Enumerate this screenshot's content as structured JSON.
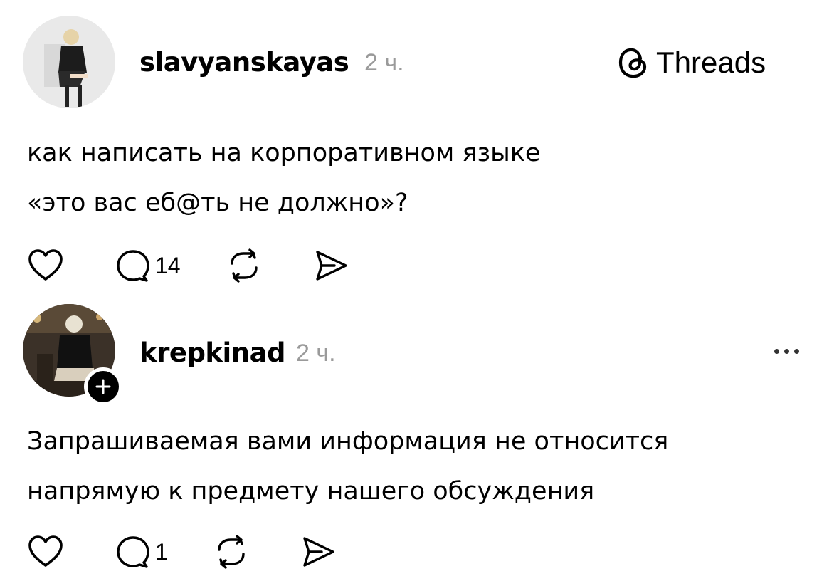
{
  "brand": {
    "name": "Threads"
  },
  "posts": [
    {
      "username": "slavyanskayas",
      "time": "2 ч.",
      "lines": [
        "как написать на корпоративном языке",
        "«это вас еб@ть не должно»?"
      ],
      "replies": "14"
    },
    {
      "username": "krepkinad",
      "time": "2 ч.",
      "lines": [
        "Запрашиваемая вами информация не относится",
        "напрямую к предмету нашего обсуждения"
      ],
      "replies": "1"
    }
  ]
}
